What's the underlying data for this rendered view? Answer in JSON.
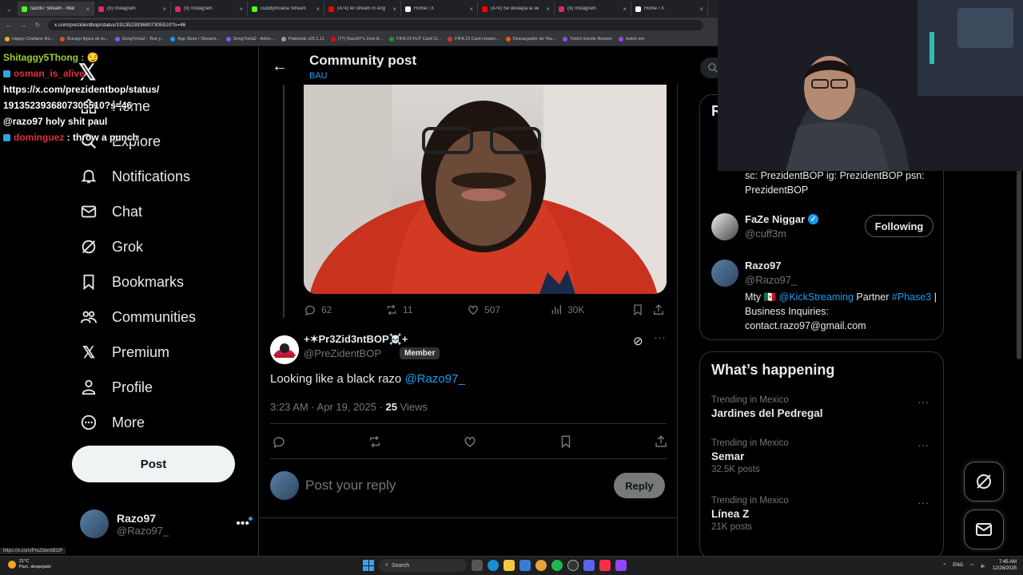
{
  "browser": {
    "tabs": [
      {
        "label": "razo97 Stream - Wat",
        "color": "#53fc18"
      },
      {
        "label": "(9) Instagram",
        "color": "#d62976"
      },
      {
        "label": "(9) Instagram",
        "color": "#d62976"
      },
      {
        "label": "cuddlymoana Stream",
        "color": "#53fc18"
      },
      {
        "label": "(474) lol stream in Ang",
        "color": "#ff0000"
      },
      {
        "label": "Home / X",
        "color": "#ffffff"
      },
      {
        "label": "(474) Se destapa la ve",
        "color": "#ff0000"
      },
      {
        "label": "(9) Instagram",
        "color": "#d62976"
      },
      {
        "label": "Home / X",
        "color": "#ffffff"
      }
    ],
    "url": "x.com/prezidentbop/status/1913523936807305510?s=46",
    "bookmarks": [
      {
        "label": "Happy Cristiano Ro...",
        "color": "#f4b400"
      },
      {
        "label": "Burago figura de to...",
        "color": "#e04e1b"
      },
      {
        "label": "SongTrivia2 - Test y...",
        "color": "#7b5cff"
      },
      {
        "label": "App Store / Streami...",
        "color": "#1d9bf0"
      },
      {
        "label": "SongTrivia2 - Advin...",
        "color": "#7b5cff"
      },
      {
        "label": "Paletools v25.1.11",
        "color": "#999999"
      },
      {
        "label": "(77) Razo97's Zest-A...",
        "color": "#ff0000"
      },
      {
        "label": "FIFA 23 FUT Card Cr...",
        "color": "#2f8f2f"
      },
      {
        "label": "FIFA 23 Card creator...",
        "color": "#e03030"
      },
      {
        "label": "Descargador de You...",
        "color": "#ff5500"
      },
      {
        "label": "Twitch Emote Resizer",
        "color": "#9146ff"
      },
      {
        "label": "twitch em",
        "color": "#9146ff"
      }
    ],
    "status_url": "https://x.com/PreZidentBOP"
  },
  "chat": {
    "line1_user": "Shitaggy5Thong :",
    "line2_user": "osman_is_alive",
    "line3_text": "https://x.com/prezidentbop/status/",
    "line4_text": "1913523936807305510?s=46",
    "line5_text": "@razo97 holy shit paul",
    "line6_user": "dominguez",
    "line6_text": ": throw a punch"
  },
  "nav": {
    "items": [
      {
        "label": "Home",
        "icon": "home-icon"
      },
      {
        "label": "Explore",
        "icon": "search-icon"
      },
      {
        "label": "Notifications",
        "icon": "bell-icon"
      },
      {
        "label": "Chat",
        "icon": "mail-icon"
      },
      {
        "label": "Grok",
        "icon": "grok-icon"
      },
      {
        "label": "Bookmarks",
        "icon": "bookmark-icon"
      },
      {
        "label": "Communities",
        "icon": "people-icon"
      },
      {
        "label": "Premium",
        "icon": "x-icon"
      },
      {
        "label": "Profile",
        "icon": "person-icon"
      },
      {
        "label": "More",
        "icon": "more-circle-icon"
      }
    ],
    "post_label": "Post",
    "account": {
      "name": "Razo97",
      "handle": "@Razo97_"
    }
  },
  "header": {
    "title": "Community post",
    "subtitle": "BAU"
  },
  "parent_post": {
    "replies": "62",
    "reposts": "11",
    "likes": "507",
    "views": "30K"
  },
  "post": {
    "author_name": "+✶Pr3Zid3ntBOP☠️+",
    "author_handle": "@PreZidentBOP",
    "member_badge": "Member",
    "text": "Looking like a black razo ",
    "mention": "@Razo97_",
    "time": "3:23 AM · Apr 19, 2025 · ",
    "views_count": "25",
    "views_label": " Views"
  },
  "reply": {
    "placeholder": "Post your reply",
    "button": "Reply"
  },
  "right": {
    "card_title_fragment": "R",
    "bio1": "sc: PrezidentBOP ig: PrezidentBOP psn: PrezidentBOP",
    "user1": {
      "name": "FaZe Niggar",
      "handle": "@cuff3m",
      "button": "Following"
    },
    "user2": {
      "name": "Razo97",
      "handle": "@Razo97_"
    },
    "bio2_prefix": "Mty 🇲🇽 ",
    "bio2_link1": "@KickStreaming",
    "bio2_mid": " Partner ",
    "bio2_link2": "#Phase3",
    "bio2_suffix": " | Business Inquiries: contact.razo97@gmail.com",
    "happening_title": "What’s happening",
    "trends": [
      {
        "meta": "Trending in Mexico",
        "name": "Jardines del Pedregal",
        "count": ""
      },
      {
        "meta": "Trending in Mexico",
        "name": "Semar",
        "count": "32.5K posts"
      },
      {
        "meta": "Trending in Mexico",
        "name": "Línea Z",
        "count": "21K posts"
      }
    ]
  },
  "taskbar": {
    "weather_temp": "21°C",
    "weather_desc": "Parc. despejado",
    "search": "Search",
    "lang": "ENG",
    "time": "7:45 AM",
    "date": "12/28/2025"
  }
}
